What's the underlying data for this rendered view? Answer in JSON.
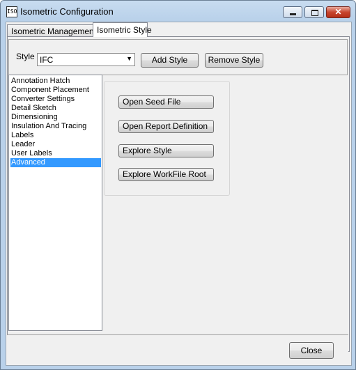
{
  "window": {
    "title": "Isometric Configuration",
    "icon": "isometric-app-icon"
  },
  "tabs": [
    {
      "label": "Isometric Management",
      "active": false
    },
    {
      "label": "Isometric Style",
      "active": true
    }
  ],
  "style_row": {
    "label": "Style",
    "selected": "IFC",
    "add_label": "Add Style",
    "remove_label": "Remove Style"
  },
  "categories": [
    "Annotation Hatch",
    "Component Placement",
    "Converter Settings",
    "Detail Sketch",
    "Dimensioning",
    "Insulation And Tracing",
    "Labels",
    "Leader",
    "User Labels",
    "Advanced"
  ],
  "selected_category": "Advanced",
  "actions": [
    "Open Seed File",
    "Open Report Definition",
    "Explore Style",
    "Explore WorkFile Root"
  ],
  "footer": {
    "close_label": "Close"
  },
  "colors": {
    "selection": "#3399ff",
    "face": "#f0f0f0",
    "frame": "#b9d1ea",
    "close_button": "#c8462f"
  }
}
